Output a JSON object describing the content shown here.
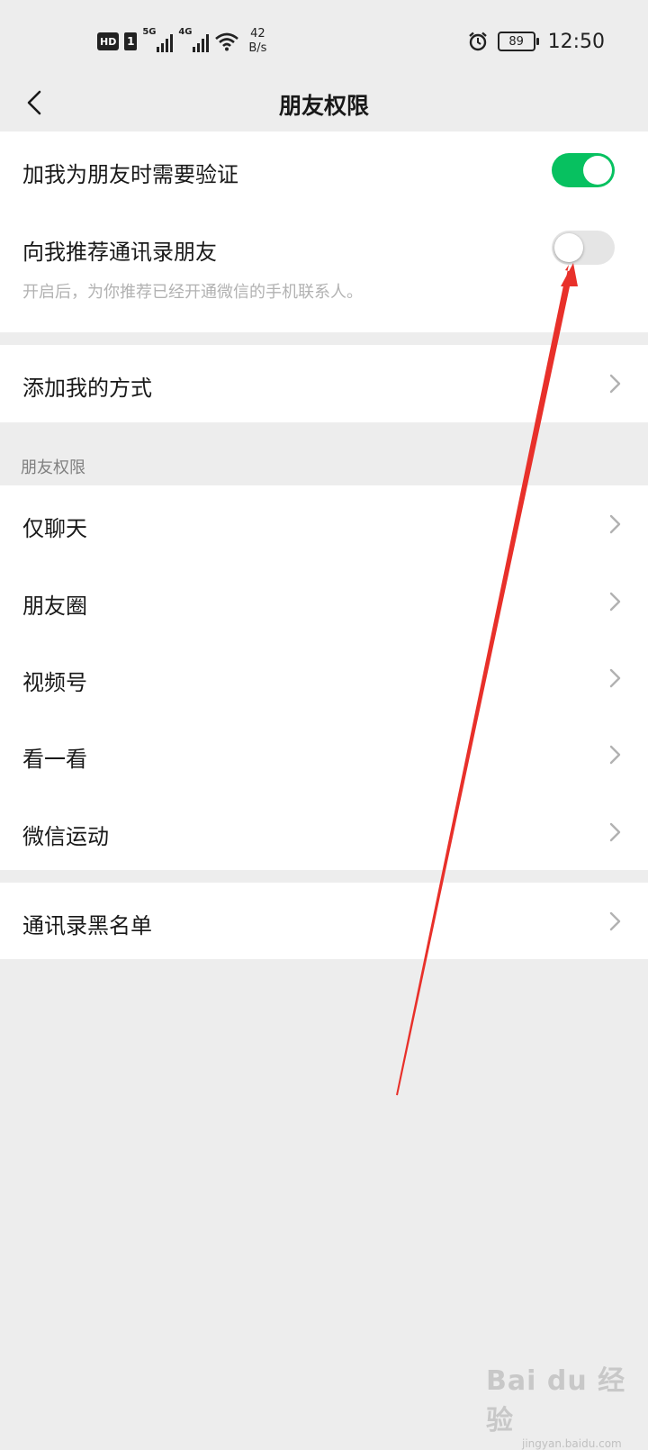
{
  "status_bar": {
    "hd_badge": "HD",
    "sim_badge": "1",
    "net1_label": "5G",
    "net2_label": "4G",
    "speed_value": "42",
    "speed_unit": "B/s",
    "battery_level": "89",
    "time": "12:50"
  },
  "nav": {
    "title": "朋友权限"
  },
  "section1": {
    "row1_label": "加我为朋友时需要验证",
    "row1_toggle_on": true,
    "row2_label": "向我推荐通讯录朋友",
    "row2_toggle_on": false,
    "row2_desc": "开启后，为你推荐已经开通微信的手机联系人。"
  },
  "section2": {
    "row_label": "添加我的方式"
  },
  "section3": {
    "header": "朋友权限",
    "items": [
      {
        "label": "仅聊天"
      },
      {
        "label": "朋友圈"
      },
      {
        "label": "视频号"
      },
      {
        "label": "看一看"
      },
      {
        "label": "微信运动"
      }
    ]
  },
  "section4": {
    "row_label": "通讯录黑名单"
  },
  "colors": {
    "toggle_on": "#07c160",
    "toggle_off": "#e5e5e5",
    "annotation_arrow": "#e8302a"
  },
  "watermark": {
    "text": "Bai du 经验",
    "url": "jingyan.baidu.com"
  }
}
